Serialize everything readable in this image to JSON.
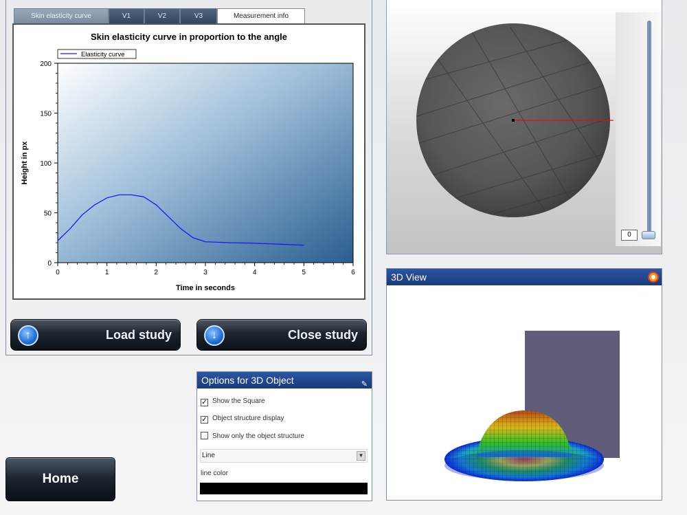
{
  "tabs": [
    "Skin elasticity curve",
    "V1",
    "V2",
    "V3",
    "Measurement info"
  ],
  "chart": {
    "title": "Skin elasticity curve in proportion to the angle",
    "legend": "Elasticity curve",
    "xlabel": "Time in seconds",
    "ylabel": "Height in px",
    "xticks": [
      "0",
      "1",
      "2",
      "3",
      "4",
      "5",
      "6"
    ],
    "yticks": [
      "0",
      "50",
      "100",
      "150",
      "200"
    ]
  },
  "chart_data": {
    "type": "line",
    "title": "Skin elasticity curve in proportion to the angle",
    "xlabel": "Time in seconds",
    "ylabel": "Height in px",
    "xlim": [
      0,
      6
    ],
    "ylim": [
      0,
      200
    ],
    "grid": false,
    "legend": "top-left",
    "series": [
      {
        "name": "Elasticity curve",
        "x": [
          0,
          0.25,
          0.5,
          0.75,
          1.0,
          1.25,
          1.5,
          1.75,
          2.0,
          2.25,
          2.5,
          2.75,
          3.0,
          3.5,
          4.0,
          4.5,
          5.0
        ],
        "y": [
          22,
          34,
          48,
          58,
          65,
          68,
          68,
          66,
          58,
          46,
          34,
          25,
          21,
          20,
          19.5,
          18.5,
          17.5
        ]
      }
    ]
  },
  "buttons": {
    "load": "Load study",
    "close": "Close study",
    "home": "Home"
  },
  "slider": {
    "value": "0"
  },
  "view3d": {
    "title": "3D View"
  },
  "options": {
    "title": "Options for 3D Object",
    "show_square": "Show the Square",
    "show_square_checked": true,
    "structure_display": "Object structure display",
    "structure_display_checked": true,
    "only_structure": "Show only the object structure",
    "only_structure_checked": false,
    "select_value": "Line",
    "line_color_label": "line color",
    "line_color": "#000000"
  },
  "colors": {
    "title_bar": "#1f4690",
    "button_dark": "#1a222c",
    "curve": "#1a1aff",
    "square": "#5f5d7a"
  }
}
